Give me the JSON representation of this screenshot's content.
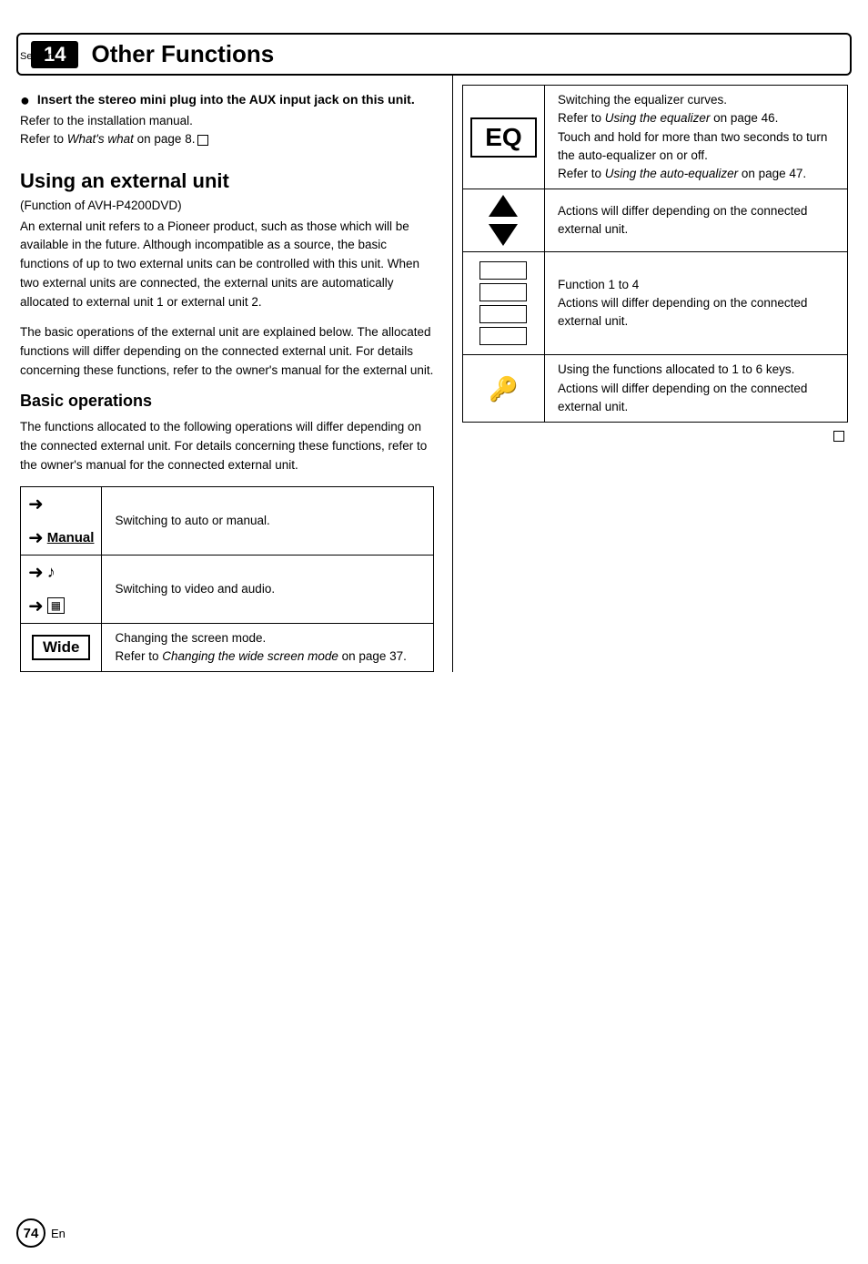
{
  "header": {
    "section_label": "Section",
    "section_number": "14",
    "title": "Other Functions"
  },
  "left": {
    "aux_title": "Insert the stereo mini plug into the AUX input jack on this unit.",
    "aux_body1": "Refer to the installation manual.",
    "aux_body2": "Refer to ",
    "aux_body2_italic": "What's what",
    "aux_body2_end": " on page 8.",
    "section_heading": "Using an external unit",
    "function_label": "(Function of AVH-P4200DVD)",
    "body1": "An external unit refers to a Pioneer product, such as those which will be available in the future. Although incompatible as a source, the basic functions of up to two external units can be controlled with this unit. When two external units are connected, the external units are automatically allocated to external unit 1 or external unit 2.",
    "body2": "The basic operations of the external unit are explained below. The allocated functions will differ depending on the connected external unit. For details concerning these functions, refer to the owner's manual for the external unit.",
    "sub_heading": "Basic operations",
    "sub_body": "The functions allocated to the following operations will differ depending on the connected external unit. For details concerning these functions, refer to the owner's manual for the connected external unit.",
    "table": [
      {
        "desc": "Switching to auto or manual.",
        "btn_label": "Manual"
      },
      {
        "desc": "Switching to video and audio."
      },
      {
        "btn_label": "Wide",
        "desc": "Changing the screen mode.\nRefer to ",
        "desc_italic": "Changing the wide screen mode",
        "desc_end": " on page 37."
      }
    ]
  },
  "right": {
    "table": [
      {
        "btn": "EQ",
        "desc": "Switching the equalizer curves.\nRefer to Using the equalizer on page 46.\nTouch and hold for more than two seconds to turn the auto-equalizer on or off.\nRefer to Using the auto-equalizer on page 47.",
        "desc_parts": [
          "Switching the equalizer curves.",
          "Refer to ",
          "Using the equalizer",
          " on page 46.",
          "Touch and hold for more than two seconds to turn the auto-equalizer on or off.",
          "Refer to ",
          "Using the auto-equalizer",
          " on page 47."
        ]
      },
      {
        "btn": "triangles",
        "desc": "Actions will differ depending on the connected external unit."
      },
      {
        "btn": "func_buttons",
        "desc": "Function 1 to 4\nActions will differ depending on the connected external unit."
      },
      {
        "btn": "key",
        "desc": "Using the functions allocated to 1 to 6 keys.\nActions will differ depending on the connected external unit."
      }
    ],
    "footer_square": "■"
  },
  "footer": {
    "page_number": "74",
    "language": "En"
  }
}
